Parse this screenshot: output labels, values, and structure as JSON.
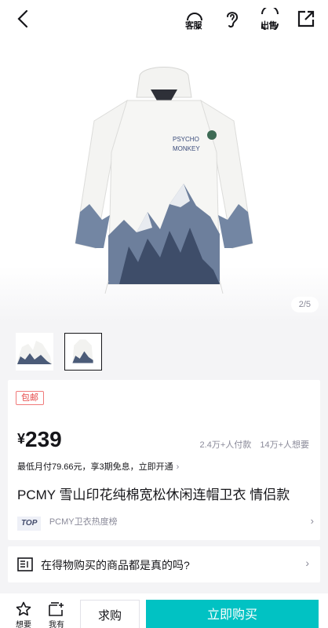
{
  "topbar": {
    "service_label": "客服",
    "sell_label": "出售"
  },
  "gallery": {
    "pager": "2/5",
    "print_text_line1": "PSYCHO",
    "print_text_line2": "MONKEY"
  },
  "product": {
    "badge": "包邮",
    "currency": "¥",
    "price": "239",
    "buyers": "2.4万+人付款",
    "wishers": "14万+人想要",
    "installment": "最低月付79.66元，享3期免息，立即开通",
    "title": "PCMY 雪山印花纯棉宽松休闲连帽卫衣 情侣款",
    "rank_tag": "TOP",
    "rank_label": "PCMY卫衣热度榜"
  },
  "question": {
    "text": "在得物购买的商品都是真的吗?"
  },
  "bottombar": {
    "favorite_label": "想要",
    "stock_label": "我有",
    "ask_label": "求购",
    "buy_label": "立即购买"
  },
  "colors": {
    "accent": "#01c2c3",
    "badge_red": "#e64646"
  }
}
